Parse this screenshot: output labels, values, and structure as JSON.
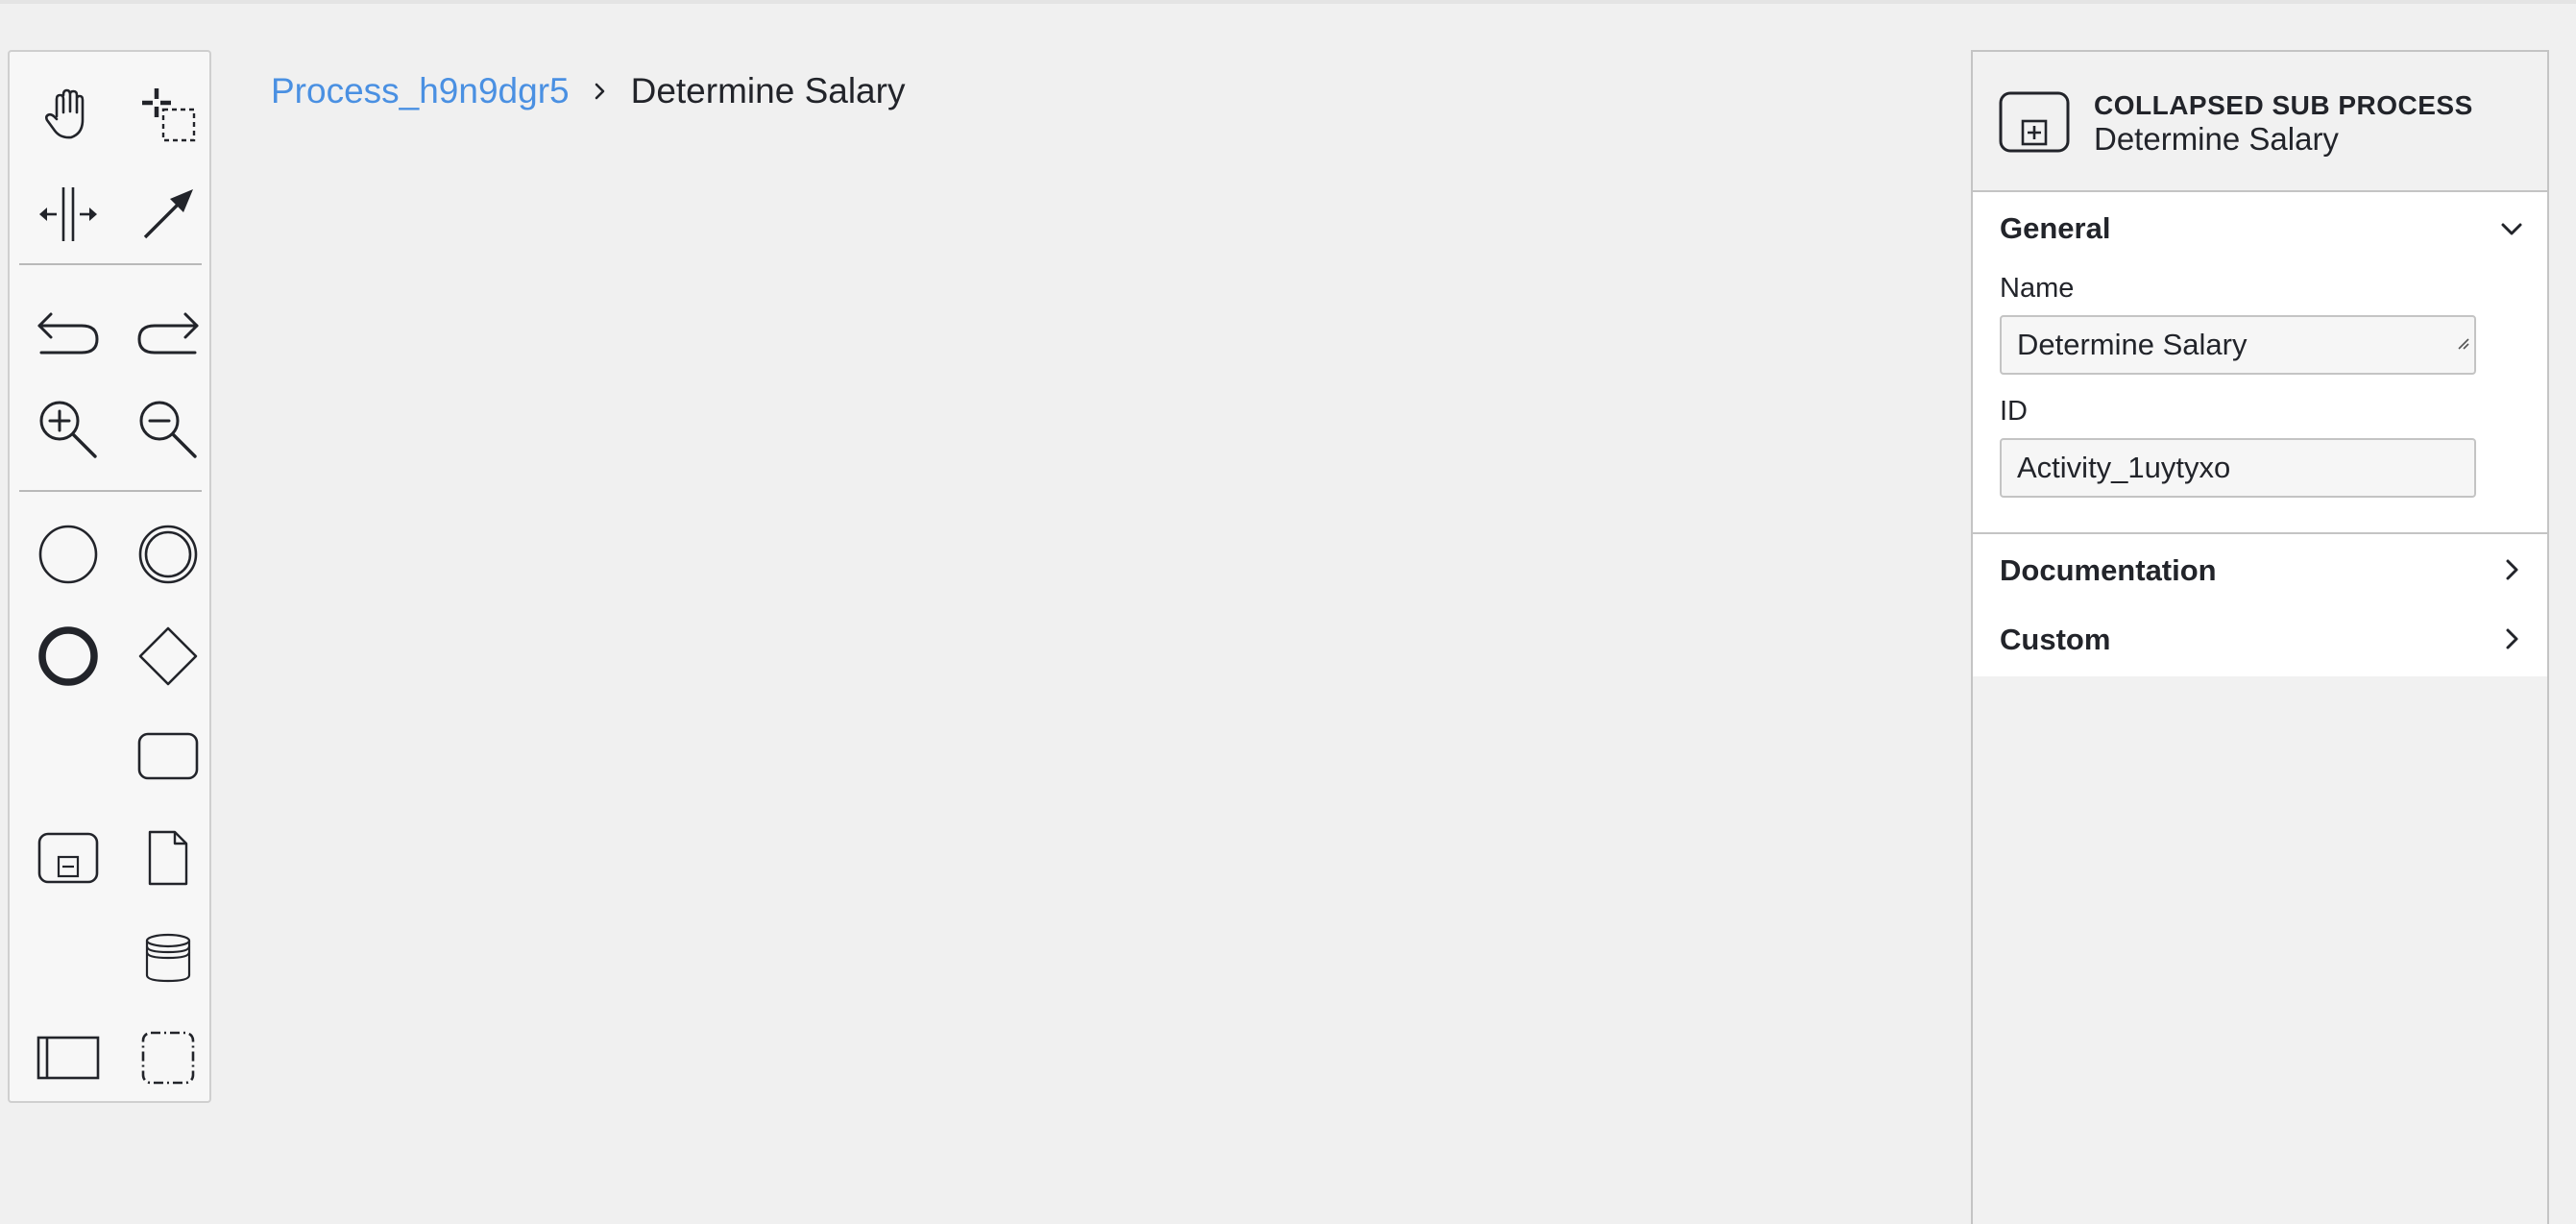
{
  "breadcrumb": {
    "root": "Process_h9n9dgr5",
    "separator_icon": "chevron-right-icon",
    "current": "Determine Salary"
  },
  "palette": {
    "tools": [
      {
        "name": "hand-tool",
        "icon": "hand-icon"
      },
      {
        "name": "lasso-tool",
        "icon": "lasso-icon"
      },
      {
        "name": "space-tool",
        "icon": "space-icon"
      },
      {
        "name": "global-connect-tool",
        "icon": "connect-arrow-icon"
      },
      {
        "name": "undo",
        "icon": "undo-icon"
      },
      {
        "name": "redo",
        "icon": "redo-icon"
      },
      {
        "name": "zoom-in",
        "icon": "zoom-in-icon"
      },
      {
        "name": "zoom-out",
        "icon": "zoom-out-icon"
      },
      {
        "name": "create-start-event",
        "icon": "start-event-icon"
      },
      {
        "name": "create-intermediate-event",
        "icon": "intermediate-event-icon"
      },
      {
        "name": "create-end-event",
        "icon": "end-event-icon"
      },
      {
        "name": "create-gateway",
        "icon": "gateway-icon"
      },
      {
        "name": "create-task",
        "icon": "task-icon"
      },
      {
        "name": "create-subprocess",
        "icon": "subprocess-collapsed-icon"
      },
      {
        "name": "create-data-object",
        "icon": "data-object-icon"
      },
      {
        "name": "create-data-store",
        "icon": "data-store-icon"
      },
      {
        "name": "create-pool",
        "icon": "participant-icon"
      },
      {
        "name": "create-group",
        "icon": "group-icon"
      }
    ]
  },
  "panel": {
    "header": {
      "icon": "collapsed-subprocess-icon",
      "type": "COLLAPSED SUB PROCESS",
      "name": "Determine Salary"
    },
    "groups": {
      "general": {
        "title": "General",
        "expanded": true,
        "name_label": "Name",
        "name_value": "Determine Salary",
        "id_label": "ID",
        "id_value": "Activity_1uytyxo"
      },
      "documentation": {
        "title": "Documentation",
        "expanded": false
      },
      "custom": {
        "title": "Custom",
        "expanded": false
      }
    }
  },
  "colors": {
    "link": "#4a90e2",
    "text": "#22242a",
    "canvas": "#f0f0f0",
    "border": "#c4c4c4"
  }
}
